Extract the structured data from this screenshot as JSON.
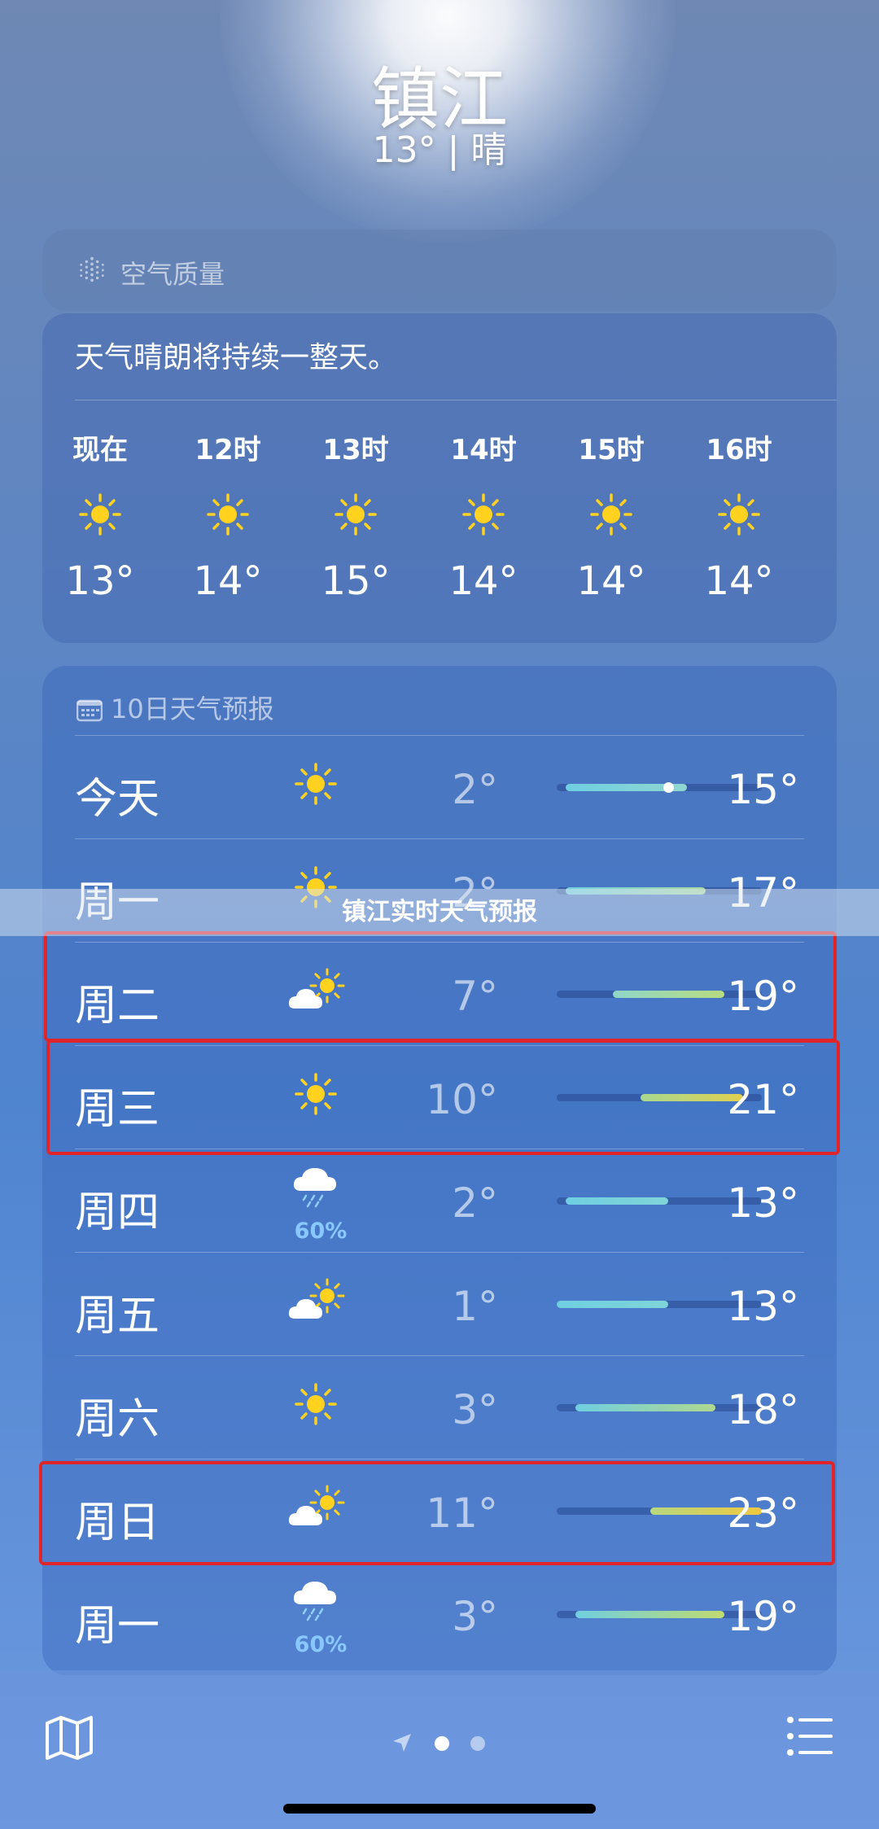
{
  "header": {
    "city": "镇江",
    "current": "13° | 晴"
  },
  "air_quality": {
    "label": "空气质量",
    "icon": "air-quality-icon"
  },
  "hourly": {
    "summary": "天气晴朗将持续一整天。",
    "items": [
      {
        "time": "现在",
        "icon": "sun-icon",
        "temp": "13°"
      },
      {
        "time": "12时",
        "icon": "sun-icon",
        "temp": "14°"
      },
      {
        "time": "13时",
        "icon": "sun-icon",
        "temp": "15°"
      },
      {
        "time": "14时",
        "icon": "sun-icon",
        "temp": "14°"
      },
      {
        "time": "15时",
        "icon": "sun-icon",
        "temp": "14°"
      },
      {
        "time": "16时",
        "icon": "sun-icon",
        "temp": "14°"
      }
    ]
  },
  "daily": {
    "header": "10日天气预报",
    "range_min": 1,
    "range_max": 23,
    "current_temp": 13,
    "rows": [
      {
        "day": "今天",
        "icon": "sun-icon",
        "low": "2°",
        "high": "15°",
        "lo": 2,
        "hi": 15,
        "grad": "linear-gradient(90deg,#6fcfe0,#8fd6d0)",
        "current": true
      },
      {
        "day": "周一",
        "icon": "sun-icon",
        "low": "2°",
        "high": "17°",
        "lo": 2,
        "hi": 17,
        "grad": "linear-gradient(90deg,#6fcfe0,#a8d8a0)"
      },
      {
        "day": "周二",
        "icon": "partly-cloudy-icon",
        "low": "7°",
        "high": "19°",
        "lo": 7,
        "hi": 19,
        "grad": "linear-gradient(90deg,#8fd6c8,#b8dc80)"
      },
      {
        "day": "周三",
        "icon": "sun-icon",
        "low": "10°",
        "high": "21°",
        "lo": 10,
        "hi": 21,
        "grad": "linear-gradient(90deg,#a8d890,#e0d050)"
      },
      {
        "day": "周四",
        "icon": "rain-icon",
        "precip": "60%",
        "low": "2°",
        "high": "13°",
        "lo": 2,
        "hi": 13,
        "grad": "linear-gradient(90deg,#6fcfe0,#7fd4d8)"
      },
      {
        "day": "周五",
        "icon": "partly-cloudy-icon",
        "low": "1°",
        "high": "13°",
        "lo": 1,
        "hi": 13,
        "grad": "linear-gradient(90deg,#6fcfe0,#7fd4d8)"
      },
      {
        "day": "周六",
        "icon": "sun-icon",
        "low": "3°",
        "high": "18°",
        "lo": 3,
        "hi": 18,
        "grad": "linear-gradient(90deg,#6fcfe0,#b0d890)"
      },
      {
        "day": "周日",
        "icon": "partly-cloudy-icon",
        "low": "11°",
        "high": "23°",
        "lo": 11,
        "hi": 23,
        "grad": "linear-gradient(90deg,#b8d880,#f0c840)"
      },
      {
        "day": "周一",
        "icon": "rain-icon",
        "precip": "60%",
        "low": "3°",
        "high": "19°",
        "lo": 3,
        "hi": 19,
        "grad": "linear-gradient(90deg,#6fcfe0,#c0da70)"
      }
    ]
  },
  "banner": {
    "text": "镇江实时天气预报"
  },
  "colors": {
    "highlight": "#e0252a",
    "sun": "#ffd21f"
  }
}
